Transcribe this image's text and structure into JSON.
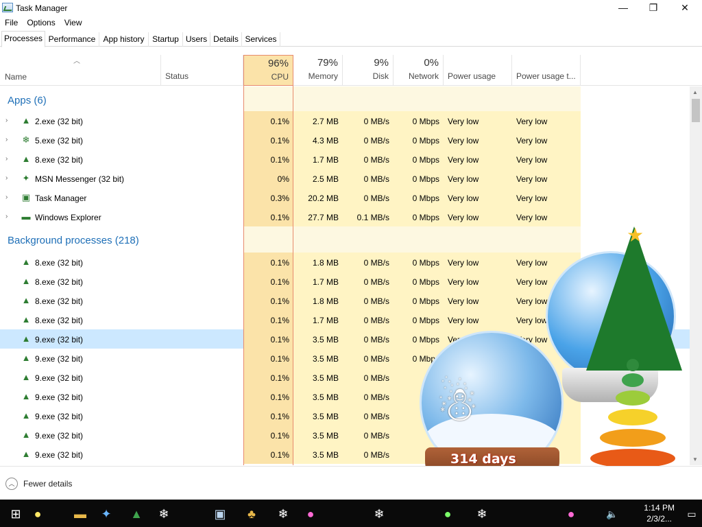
{
  "window": {
    "title": "Task Manager",
    "minimize": "—",
    "restore": "❐",
    "close": "✕"
  },
  "menu": [
    "File",
    "Options",
    "View"
  ],
  "tabs": [
    "Processes",
    "Performance",
    "App history",
    "Startup",
    "Users",
    "Details",
    "Services"
  ],
  "active_tab": "Processes",
  "columns": {
    "name": "Name",
    "status": "Status",
    "cpu": {
      "pct": "96%",
      "label": "CPU"
    },
    "memory": {
      "pct": "79%",
      "label": "Memory"
    },
    "disk": {
      "pct": "9%",
      "label": "Disk"
    },
    "network": {
      "pct": "0%",
      "label": "Network"
    },
    "power": "Power usage",
    "power_trend": "Power usage t..."
  },
  "groups": {
    "apps": "Apps (6)",
    "background": "Background processes (218)"
  },
  "apps": [
    {
      "name": "2.exe (32 bit)",
      "cpu": "0.1%",
      "memory": "2.7 MB",
      "disk": "0 MB/s",
      "network": "0 Mbps",
      "power": "Very low",
      "power_trend": "Very low",
      "icon": "tree-icon"
    },
    {
      "name": "5.exe (32 bit)",
      "cpu": "0.1%",
      "memory": "4.3 MB",
      "disk": "0 MB/s",
      "network": "0 Mbps",
      "power": "Very low",
      "power_trend": "Very low",
      "icon": "snowflake-icon"
    },
    {
      "name": "8.exe (32 bit)",
      "cpu": "0.1%",
      "memory": "1.7 MB",
      "disk": "0 MB/s",
      "network": "0 Mbps",
      "power": "Very low",
      "power_trend": "Very low",
      "icon": "tree-icon"
    },
    {
      "name": "MSN Messenger (32 bit)",
      "cpu": "0%",
      "memory": "2.5 MB",
      "disk": "0 MB/s",
      "network": "0 Mbps",
      "power": "Very low",
      "power_trend": "Very low",
      "icon": "msn-icon"
    },
    {
      "name": "Task Manager",
      "cpu": "0.3%",
      "memory": "20.2 MB",
      "disk": "0 MB/s",
      "network": "0 Mbps",
      "power": "Very low",
      "power_trend": "Very low",
      "icon": "task-manager-icon"
    },
    {
      "name": "Windows Explorer",
      "cpu": "0.1%",
      "memory": "27.7 MB",
      "disk": "0.1 MB/s",
      "network": "0 Mbps",
      "power": "Very low",
      "power_trend": "Very low",
      "icon": "folder-icon"
    }
  ],
  "background": [
    {
      "name": "8.exe (32 bit)",
      "cpu": "0.1%",
      "memory": "1.8 MB",
      "disk": "0 MB/s",
      "network": "0 Mbps",
      "power": "Very low",
      "power_trend": "Very low"
    },
    {
      "name": "8.exe (32 bit)",
      "cpu": "0.1%",
      "memory": "1.7 MB",
      "disk": "0 MB/s",
      "network": "0 Mbps",
      "power": "Very low",
      "power_trend": "Very low"
    },
    {
      "name": "8.exe (32 bit)",
      "cpu": "0.1%",
      "memory": "1.8 MB",
      "disk": "0 MB/s",
      "network": "0 Mbps",
      "power": "Very low",
      "power_trend": "Very low"
    },
    {
      "name": "8.exe (32 bit)",
      "cpu": "0.1%",
      "memory": "1.7 MB",
      "disk": "0 MB/s",
      "network": "0 Mbps",
      "power": "Very low",
      "power_trend": "Very low"
    },
    {
      "name": "9.exe (32 bit)",
      "cpu": "0.1%",
      "memory": "3.5 MB",
      "disk": "0 MB/s",
      "network": "0 Mbps",
      "power": "Very low",
      "power_trend": "Very low",
      "selected": true
    },
    {
      "name": "9.exe (32 bit)",
      "cpu": "0.1%",
      "memory": "3.5 MB",
      "disk": "0 MB/s",
      "network": "0 Mbps",
      "power": "",
      "power_trend": ""
    },
    {
      "name": "9.exe (32 bit)",
      "cpu": "0.1%",
      "memory": "3.5 MB",
      "disk": "0 MB/s",
      "network": "",
      "power": "",
      "power_trend": ""
    },
    {
      "name": "9.exe (32 bit)",
      "cpu": "0.1%",
      "memory": "3.5 MB",
      "disk": "0 MB/s",
      "network": "",
      "power": "",
      "power_trend": ""
    },
    {
      "name": "9.exe (32 bit)",
      "cpu": "0.1%",
      "memory": "3.5 MB",
      "disk": "0 MB/s",
      "network": "",
      "power": "",
      "power_trend": ""
    },
    {
      "name": "9.exe (32 bit)",
      "cpu": "0.1%",
      "memory": "3.5 MB",
      "disk": "0 MB/s",
      "network": "",
      "power": "",
      "power_trend": ""
    },
    {
      "name": "9.exe (32 bit)",
      "cpu": "0.1%",
      "memory": "3.5 MB",
      "disk": "0 MB/s",
      "network": "",
      "power": "",
      "power_trend": ""
    }
  ],
  "footer": {
    "fewer_details": "Fewer details"
  },
  "overlay": {
    "days_text": "314 days"
  },
  "taskbar": {
    "time": "1:14 PM",
    "date": "2/3/2..."
  },
  "colors": {
    "cpu_highlight": "#fbe3a9",
    "usage_light": "#fff4c4",
    "selection": "#cce8ff",
    "group_text": "#1e6fb7"
  }
}
